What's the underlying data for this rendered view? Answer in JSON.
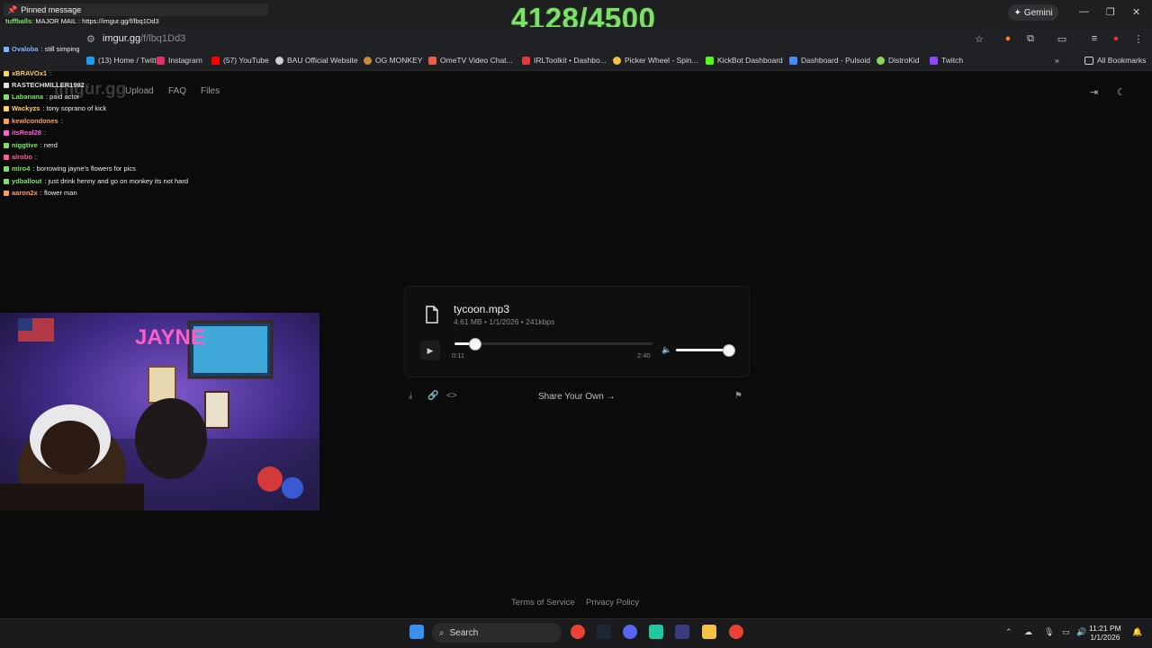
{
  "overlay": {
    "counter": "4128/4500",
    "pinned_label": "Pinned message",
    "pinned_user": "tuffballs",
    "pinned_text": ": MAJOR MAIL : https://imgur.gg/f/lbq1Dd3",
    "chat": [
      {
        "user": "Ovaloba",
        "text": ": still simping",
        "color": "#7fb2ff"
      },
      {
        "user": "xBRAVOx1",
        "text": ":",
        "color": "#ffd35c"
      },
      {
        "user": "RASTECHMILLER1992",
        "text": ":",
        "color": "#e0e0e0"
      },
      {
        "user": "Labanana",
        "text": ": paid actor",
        "color": "#7ee06a"
      },
      {
        "user": "Wackyzs",
        "text": ": tony soprano of kick",
        "color": "#ffd35c"
      },
      {
        "user": "kewlcondones",
        "text": ":",
        "color": "#ff9f5c"
      },
      {
        "user": "itsReal28",
        "text": ":",
        "color": "#ff5cd6"
      },
      {
        "user": "niggtive",
        "text": ": nerd",
        "color": "#7ee06a"
      },
      {
        "user": "alrobo",
        "text": ":",
        "color": "#ff5c8a"
      },
      {
        "user": "miro4",
        "text": ": borrowing jayne's flowers for pics",
        "color": "#7ee06a"
      },
      {
        "user": "ydballout",
        "text": ": just drink henny and go on monkey its not hard",
        "color": "#7ee06a"
      },
      {
        "user": "aaron2x",
        "text": ": flower man",
        "color": "#ff9f5c"
      }
    ]
  },
  "browser": {
    "gemini_label": "Gemini",
    "url_host": "imgur.gg",
    "url_path": "/f/lbq1Dd3",
    "bookmarks": [
      {
        "label": "(13) Home / Twitter",
        "color": "#1d9bf0"
      },
      {
        "label": "Instagram",
        "color": "#e1306c"
      },
      {
        "label": "(57) YouTube",
        "color": "#ff0000"
      },
      {
        "label": "BAU Official Website",
        "color": "#cfcfcf"
      },
      {
        "label": "OG MONKEY",
        "color": "#c98a3a"
      },
      {
        "label": "OmeTV Video Chat...",
        "color": "#f05a4a"
      },
      {
        "label": "IRLToolkit • Dashbo...",
        "color": "#e03a3a"
      },
      {
        "label": "Picker Wheel - Spin...",
        "color": "#f5c242"
      },
      {
        "label": "KickBot Dashboard",
        "color": "#53fc18"
      },
      {
        "label": "Dashboard - Pulsoid",
        "color": "#4a8af5"
      },
      {
        "label": "DistroKid",
        "color": "#8ad45a"
      },
      {
        "label": "Twitch",
        "color": "#9146ff"
      }
    ],
    "all_bookmarks": "All Bookmarks"
  },
  "site": {
    "logo": "imgur.gg",
    "nav": [
      "Upload",
      "FAQ",
      "Files"
    ]
  },
  "player": {
    "filename": "tycoon.mp3",
    "meta": "4.61 MB • 1/1/2026 • 241kbps",
    "current_time": "0:11",
    "total_time": "2:40",
    "progress": 0.1,
    "volume": 1.0
  },
  "actions": {
    "share_label": "Share Your Own →"
  },
  "footer": {
    "terms": "Terms of Service",
    "privacy": "Privacy Policy"
  },
  "taskbar": {
    "search_label": "Search",
    "time": "11:21 PM",
    "date": "1/1/2026"
  }
}
